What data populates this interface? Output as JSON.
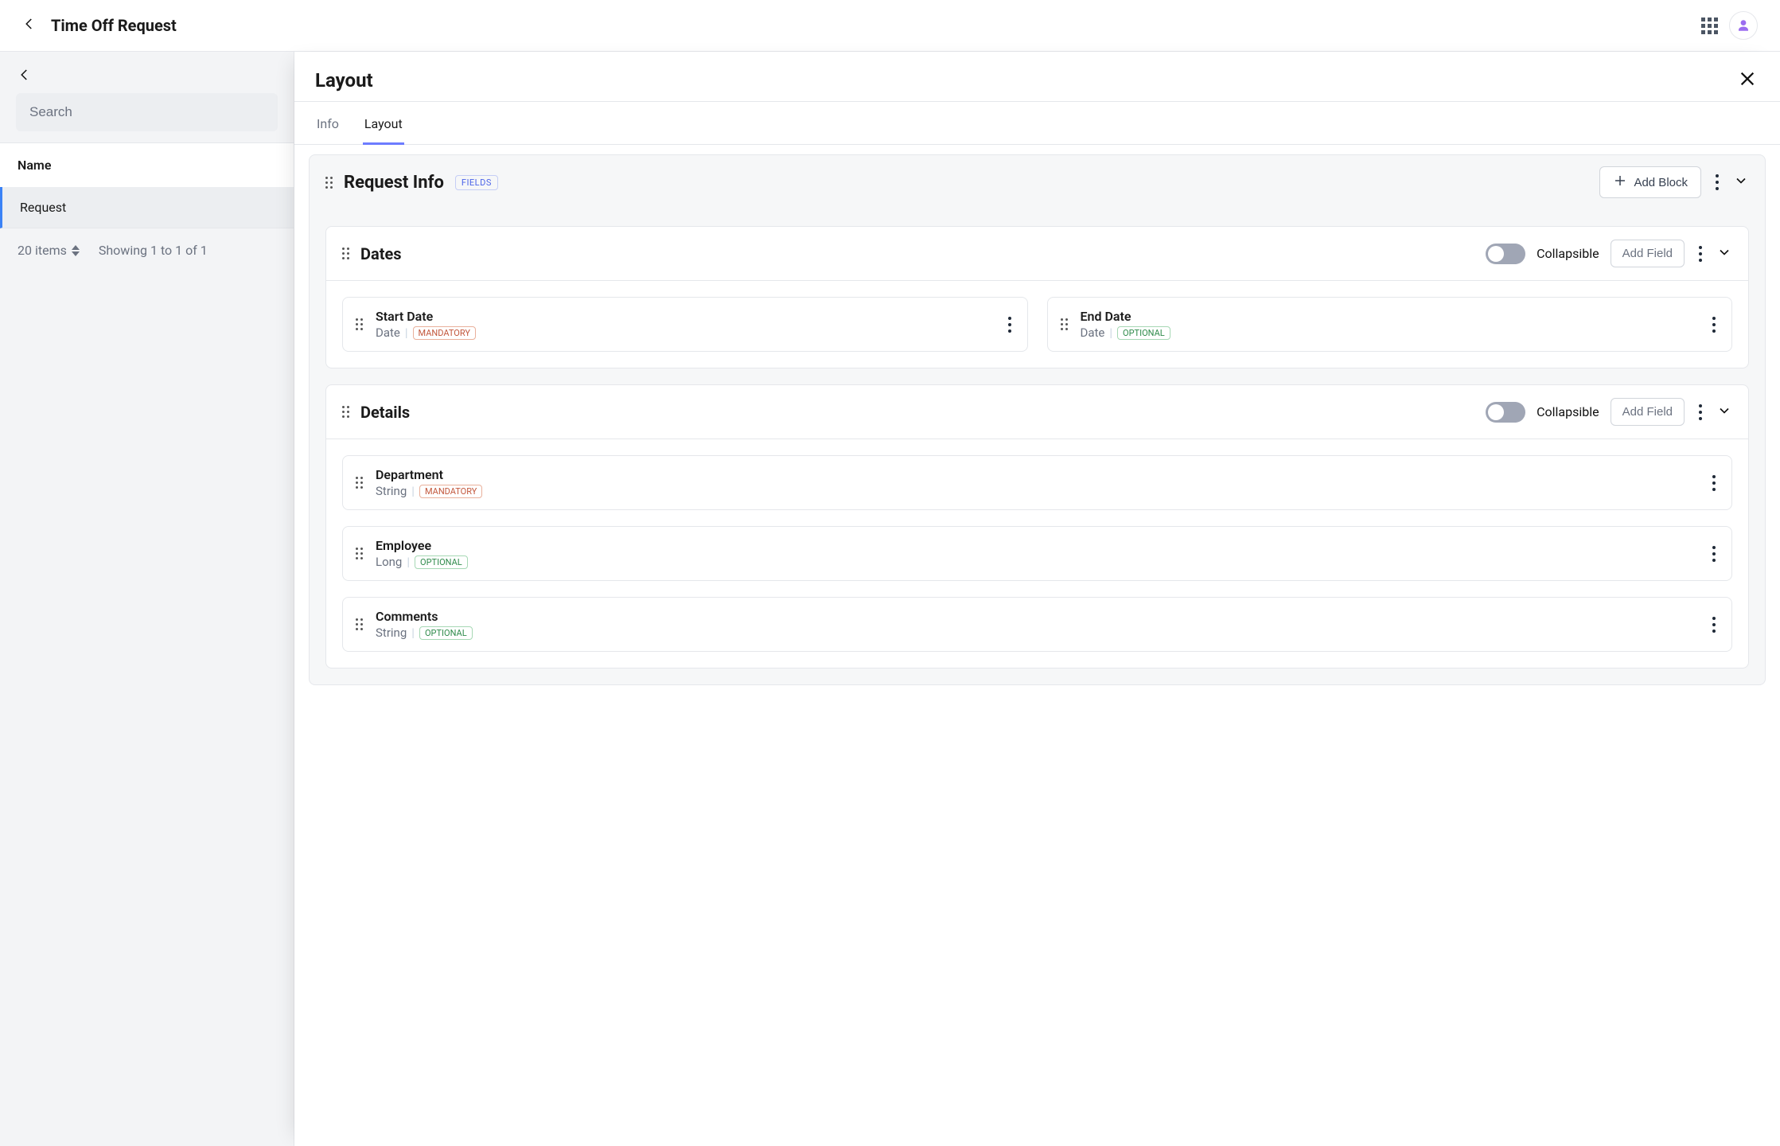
{
  "header": {
    "title": "Time Off Request"
  },
  "sidebar": {
    "search_placeholder": "Search",
    "col_header": "Name",
    "rows": [
      {
        "name": "Request"
      }
    ],
    "page_size_label": "20 items",
    "showing_label": "Showing 1 to 1 of 1"
  },
  "panel": {
    "title": "Layout",
    "tabs": [
      {
        "label": "Info",
        "active": false
      },
      {
        "label": "Layout",
        "active": true
      }
    ],
    "block": {
      "title": "Request Info",
      "badge": "FIELDS",
      "add_block_label": "Add Block"
    },
    "subblocks": [
      {
        "title": "Dates",
        "collapsible_label": "Collapsible",
        "add_field_label": "Add Field",
        "fields_layout": "row",
        "fields": [
          {
            "title": "Start Date",
            "type": "Date",
            "required": "MANDATORY"
          },
          {
            "title": "End Date",
            "type": "Date",
            "required": "OPTIONAL"
          }
        ]
      },
      {
        "title": "Details",
        "collapsible_label": "Collapsible",
        "add_field_label": "Add Field",
        "fields_layout": "col",
        "fields": [
          {
            "title": "Department",
            "type": "String",
            "required": "MANDATORY"
          },
          {
            "title": "Employee",
            "type": "Long",
            "required": "OPTIONAL"
          },
          {
            "title": "Comments",
            "type": "String",
            "required": "OPTIONAL"
          }
        ]
      }
    ]
  }
}
